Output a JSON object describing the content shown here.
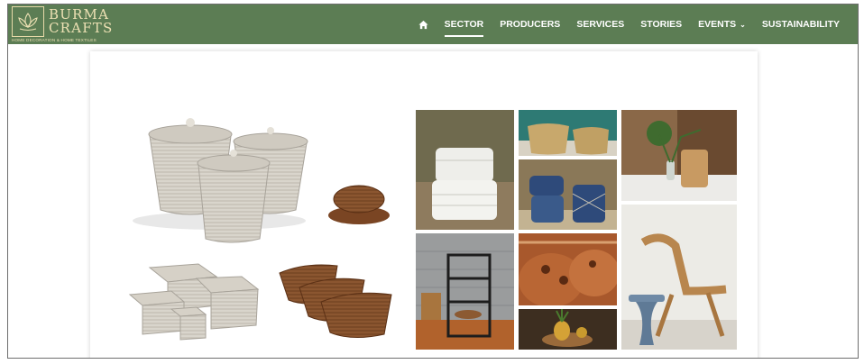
{
  "brand": {
    "name_line1": "BURMA",
    "name_line2": "CRAFTS",
    "tagline": "HOME DECORATION & HOME TEXTILES",
    "colors": {
      "nav_bg": "#5c7d54",
      "logo_gold": "#ece0b3"
    }
  },
  "nav": {
    "home_icon": "home-icon",
    "items": [
      {
        "label": "SECTOR",
        "active": true
      },
      {
        "label": "PRODUCERS"
      },
      {
        "label": "SERVICES"
      },
      {
        "label": "STORIES"
      },
      {
        "label": "EVENTS",
        "has_dropdown": true,
        "dropdown_icon": "chevron-down-icon"
      },
      {
        "label": "SUSTAINABILITY"
      }
    ]
  }
}
